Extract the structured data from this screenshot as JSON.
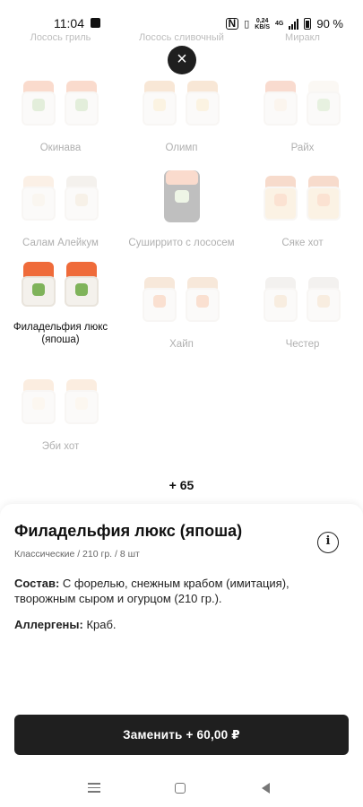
{
  "status_bar": {
    "time": "11:04",
    "nfc": "N",
    "speed_value": "0,24",
    "speed_unit": "KB/S",
    "network": "4G",
    "battery": "90 %"
  },
  "top_row_labels": [
    "Лосось гриль",
    "Лосось сливочный",
    "Миракл"
  ],
  "grid": {
    "items": [
      {
        "label": "Окинава",
        "active": false
      },
      {
        "label": "Олимп",
        "active": false
      },
      {
        "label": "Райх",
        "active": false
      },
      {
        "label": "Салам Алейкум",
        "active": false
      },
      {
        "label": "Сушир­рито с лососем",
        "active": false
      },
      {
        "label": "Сяке хот",
        "active": false
      },
      {
        "label": "Филадельфия люкс (япоша)",
        "active": true
      },
      {
        "label": "Хайп",
        "active": false
      },
      {
        "label": "Честер",
        "active": false
      },
      {
        "label": "Эби хот",
        "active": false
      }
    ],
    "more_count": "+ 65"
  },
  "close_icon": "close-icon",
  "sheet": {
    "title": "Филадельфия люкс (япоша)",
    "meta": "Классические / 210 гр. / 8 шт",
    "composition_label": "Состав:",
    "composition_text": " С форелью, снежным крабом (имитация), творожным сыром и огурцом (210 гр.).",
    "allergens_label": "Аллергены:",
    "allergens_text": " Краб.",
    "info_glyph": "i"
  },
  "replace_button": "Заменить + 60,00 ₽",
  "colors": {
    "accent_dark": "#1f1f1f",
    "salmon": "#ef6b3a"
  }
}
